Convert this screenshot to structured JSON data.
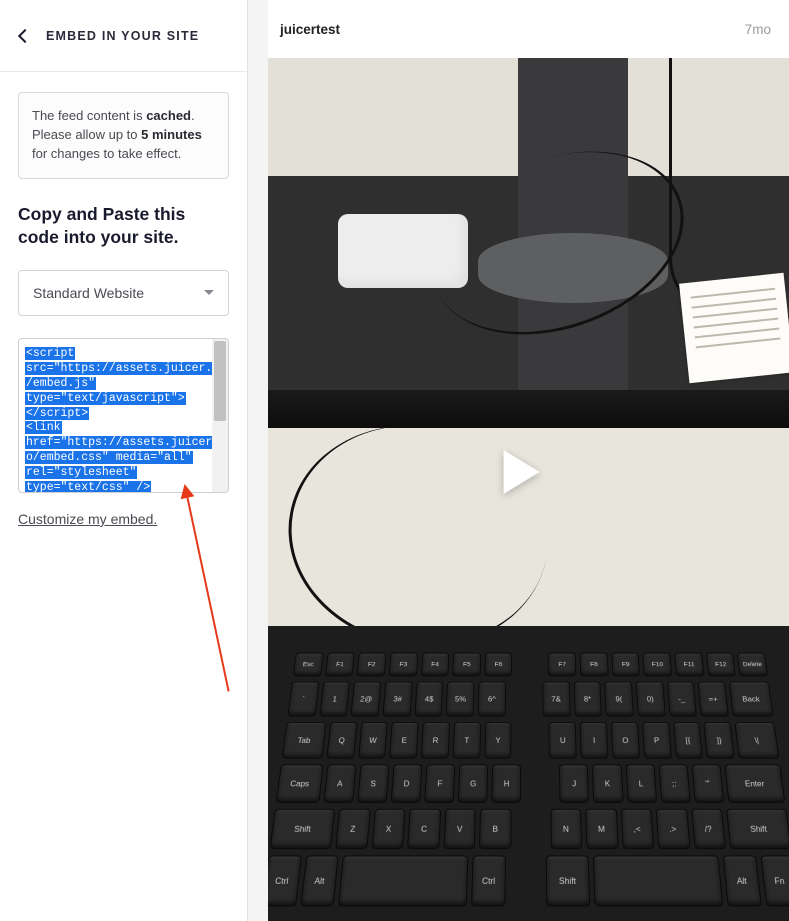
{
  "sidebar": {
    "title": "EMBED IN YOUR SITE",
    "notice": {
      "pre": "The feed content is ",
      "bold1": "cached",
      "mid": ". Please allow up to ",
      "bold2": "5 minutes",
      "post": " for changes to take effect."
    },
    "section_title": "Copy and Paste this code into your site.",
    "dropdown": {
      "selected": "Standard Website"
    },
    "embed_code": {
      "l1": "<script",
      "l2": "src=\"https://assets.juicer.io",
      "l3": "/embed.js\"",
      "l4": "type=\"text/javascript\">",
      "l5": "</script>",
      "l6": "<link",
      "l7": "href=\"https://assets.juicer.i",
      "l8": "o/embed.css\" media=\"all\"",
      "l9": "rel=\"stylesheet\"",
      "l10": "type=\"text/css\" />"
    },
    "customize_link": "Customize my embed."
  },
  "post": {
    "username": "juicertest",
    "timestamp": "7mo"
  },
  "keyboard": {
    "r1": [
      "Esc",
      "F1",
      "F2",
      "F3",
      "F4",
      "F5",
      "F6",
      "F7",
      "F8",
      "F9",
      "F10",
      "F11",
      "F12",
      "Delete"
    ],
    "r2": [
      "`",
      "1",
      "2@",
      "3#",
      "4$",
      "5%",
      "6^",
      "7&",
      "8*",
      "9(",
      "0)",
      "-_",
      "=+",
      "Back"
    ],
    "r3": [
      "Tab",
      "Q",
      "W",
      "E",
      "R",
      "T",
      "Y",
      "U",
      "I",
      "O",
      "P",
      "[{",
      "]}",
      "\\|"
    ],
    "r4": [
      "Caps",
      "A",
      "S",
      "D",
      "F",
      "G",
      "H",
      "J",
      "K",
      "L",
      ";:",
      "'\"",
      "Enter"
    ],
    "r5": [
      "Shift",
      "Z",
      "X",
      "C",
      "V",
      "B",
      "N",
      "M",
      ",<",
      ".>",
      "/?",
      "Shift"
    ],
    "r6": [
      "Ctrl",
      "Alt",
      "",
      "Ctrl",
      "Shift",
      "",
      "Alt",
      "Fn"
    ]
  }
}
